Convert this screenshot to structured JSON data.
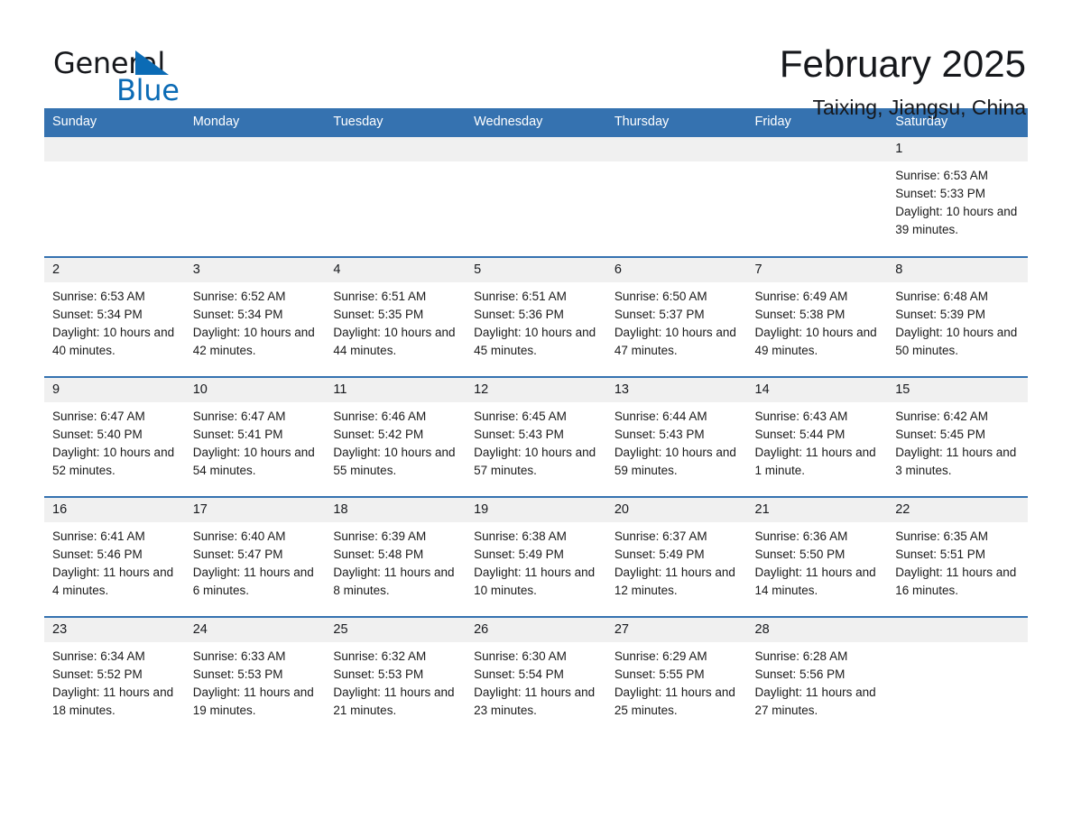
{
  "logo": {
    "word1": "General",
    "word2": "Blue",
    "triangle_color": "#0b6bb5"
  },
  "header": {
    "title": "February 2025",
    "subtitle": "Taixing, Jiangsu, China"
  },
  "theme": {
    "header_blue": "#3572b0",
    "daynum_gray": "#f0f0f0",
    "separator_blue": "#3572b0"
  },
  "calendar": {
    "weekday_headers": [
      "Sunday",
      "Monday",
      "Tuesday",
      "Wednesday",
      "Thursday",
      "Friday",
      "Saturday"
    ],
    "labels": {
      "sunrise": "Sunrise:",
      "sunset": "Sunset:",
      "daylight": "Daylight:"
    },
    "weeks": [
      [
        {
          "day": "",
          "empty": true
        },
        {
          "day": "",
          "empty": true
        },
        {
          "day": "",
          "empty": true
        },
        {
          "day": "",
          "empty": true
        },
        {
          "day": "",
          "empty": true
        },
        {
          "day": "",
          "empty": true
        },
        {
          "day": "1",
          "sunrise": "Sunrise: 6:53 AM",
          "sunset": "Sunset: 5:33 PM",
          "daylight": "Daylight: 10 hours and 39 minutes."
        }
      ],
      [
        {
          "day": "2",
          "sunrise": "Sunrise: 6:53 AM",
          "sunset": "Sunset: 5:34 PM",
          "daylight": "Daylight: 10 hours and 40 minutes."
        },
        {
          "day": "3",
          "sunrise": "Sunrise: 6:52 AM",
          "sunset": "Sunset: 5:34 PM",
          "daylight": "Daylight: 10 hours and 42 minutes."
        },
        {
          "day": "4",
          "sunrise": "Sunrise: 6:51 AM",
          "sunset": "Sunset: 5:35 PM",
          "daylight": "Daylight: 10 hours and 44 minutes."
        },
        {
          "day": "5",
          "sunrise": "Sunrise: 6:51 AM",
          "sunset": "Sunset: 5:36 PM",
          "daylight": "Daylight: 10 hours and 45 minutes."
        },
        {
          "day": "6",
          "sunrise": "Sunrise: 6:50 AM",
          "sunset": "Sunset: 5:37 PM",
          "daylight": "Daylight: 10 hours and 47 minutes."
        },
        {
          "day": "7",
          "sunrise": "Sunrise: 6:49 AM",
          "sunset": "Sunset: 5:38 PM",
          "daylight": "Daylight: 10 hours and 49 minutes."
        },
        {
          "day": "8",
          "sunrise": "Sunrise: 6:48 AM",
          "sunset": "Sunset: 5:39 PM",
          "daylight": "Daylight: 10 hours and 50 minutes."
        }
      ],
      [
        {
          "day": "9",
          "sunrise": "Sunrise: 6:47 AM",
          "sunset": "Sunset: 5:40 PM",
          "daylight": "Daylight: 10 hours and 52 minutes."
        },
        {
          "day": "10",
          "sunrise": "Sunrise: 6:47 AM",
          "sunset": "Sunset: 5:41 PM",
          "daylight": "Daylight: 10 hours and 54 minutes."
        },
        {
          "day": "11",
          "sunrise": "Sunrise: 6:46 AM",
          "sunset": "Sunset: 5:42 PM",
          "daylight": "Daylight: 10 hours and 55 minutes."
        },
        {
          "day": "12",
          "sunrise": "Sunrise: 6:45 AM",
          "sunset": "Sunset: 5:43 PM",
          "daylight": "Daylight: 10 hours and 57 minutes."
        },
        {
          "day": "13",
          "sunrise": "Sunrise: 6:44 AM",
          "sunset": "Sunset: 5:43 PM",
          "daylight": "Daylight: 10 hours and 59 minutes."
        },
        {
          "day": "14",
          "sunrise": "Sunrise: 6:43 AM",
          "sunset": "Sunset: 5:44 PM",
          "daylight": "Daylight: 11 hours and 1 minute."
        },
        {
          "day": "15",
          "sunrise": "Sunrise: 6:42 AM",
          "sunset": "Sunset: 5:45 PM",
          "daylight": "Daylight: 11 hours and 3 minutes."
        }
      ],
      [
        {
          "day": "16",
          "sunrise": "Sunrise: 6:41 AM",
          "sunset": "Sunset: 5:46 PM",
          "daylight": "Daylight: 11 hours and 4 minutes."
        },
        {
          "day": "17",
          "sunrise": "Sunrise: 6:40 AM",
          "sunset": "Sunset: 5:47 PM",
          "daylight": "Daylight: 11 hours and 6 minutes."
        },
        {
          "day": "18",
          "sunrise": "Sunrise: 6:39 AM",
          "sunset": "Sunset: 5:48 PM",
          "daylight": "Daylight: 11 hours and 8 minutes."
        },
        {
          "day": "19",
          "sunrise": "Sunrise: 6:38 AM",
          "sunset": "Sunset: 5:49 PM",
          "daylight": "Daylight: 11 hours and 10 minutes."
        },
        {
          "day": "20",
          "sunrise": "Sunrise: 6:37 AM",
          "sunset": "Sunset: 5:49 PM",
          "daylight": "Daylight: 11 hours and 12 minutes."
        },
        {
          "day": "21",
          "sunrise": "Sunrise: 6:36 AM",
          "sunset": "Sunset: 5:50 PM",
          "daylight": "Daylight: 11 hours and 14 minutes."
        },
        {
          "day": "22",
          "sunrise": "Sunrise: 6:35 AM",
          "sunset": "Sunset: 5:51 PM",
          "daylight": "Daylight: 11 hours and 16 minutes."
        }
      ],
      [
        {
          "day": "23",
          "sunrise": "Sunrise: 6:34 AM",
          "sunset": "Sunset: 5:52 PM",
          "daylight": "Daylight: 11 hours and 18 minutes."
        },
        {
          "day": "24",
          "sunrise": "Sunrise: 6:33 AM",
          "sunset": "Sunset: 5:53 PM",
          "daylight": "Daylight: 11 hours and 19 minutes."
        },
        {
          "day": "25",
          "sunrise": "Sunrise: 6:32 AM",
          "sunset": "Sunset: 5:53 PM",
          "daylight": "Daylight: 11 hours and 21 minutes."
        },
        {
          "day": "26",
          "sunrise": "Sunrise: 6:30 AM",
          "sunset": "Sunset: 5:54 PM",
          "daylight": "Daylight: 11 hours and 23 minutes."
        },
        {
          "day": "27",
          "sunrise": "Sunrise: 6:29 AM",
          "sunset": "Sunset: 5:55 PM",
          "daylight": "Daylight: 11 hours and 25 minutes."
        },
        {
          "day": "28",
          "sunrise": "Sunrise: 6:28 AM",
          "sunset": "Sunset: 5:56 PM",
          "daylight": "Daylight: 11 hours and 27 minutes."
        },
        {
          "day": "",
          "empty": true
        }
      ]
    ]
  }
}
